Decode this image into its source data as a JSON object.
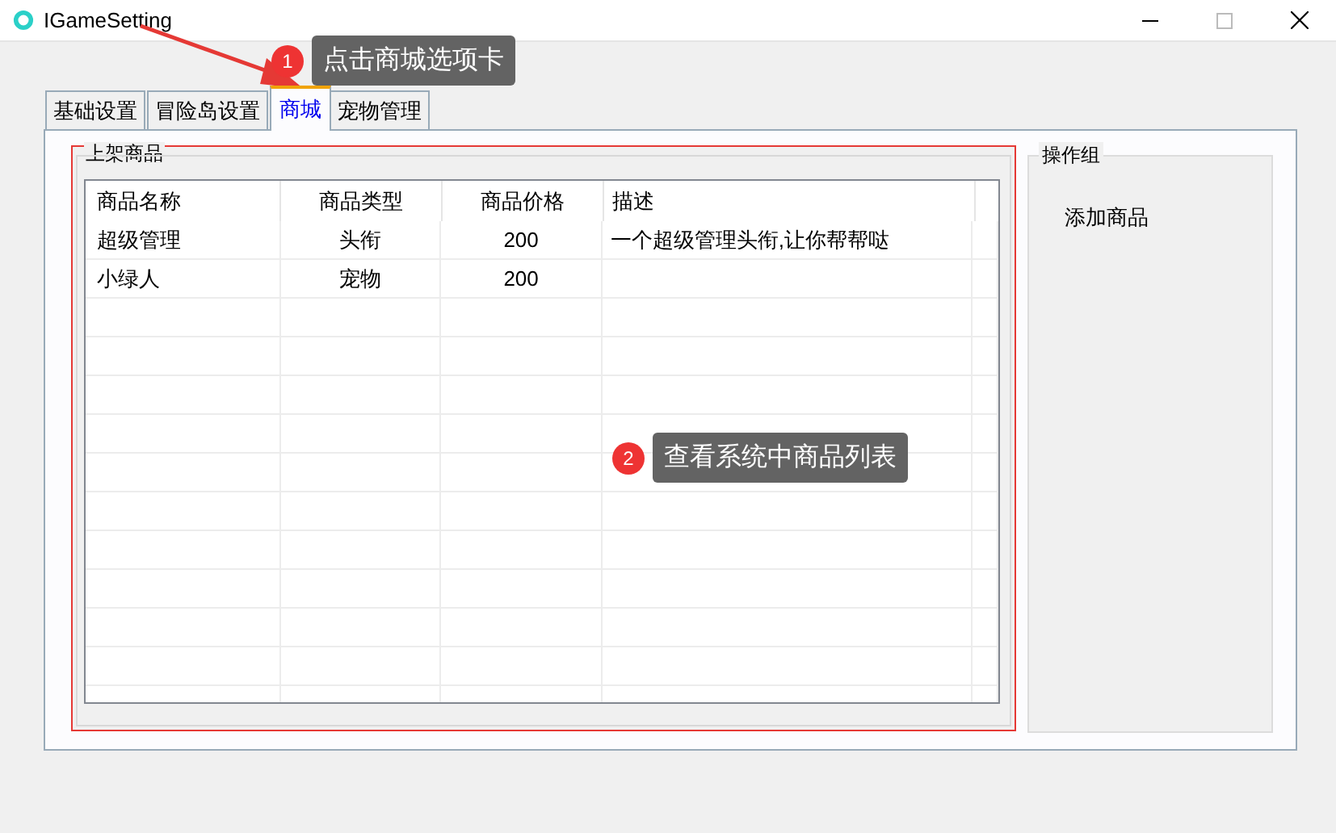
{
  "window": {
    "title": "IGameSetting"
  },
  "tabs": [
    {
      "label": "基础设置",
      "selected": false
    },
    {
      "label": "冒险岛设置",
      "selected": false
    },
    {
      "label": "商城",
      "selected": true
    },
    {
      "label": "宠物管理",
      "selected": false
    }
  ],
  "product_group": {
    "title": "上架商品",
    "table": {
      "columns": [
        "商品名称",
        "商品类型",
        "商品价格",
        "描述"
      ],
      "rows": [
        [
          "超级管理",
          "头衔",
          "200",
          "一个超级管理头衔,让你帮帮哒"
        ],
        [
          "小绿人",
          "宠物",
          "200",
          ""
        ]
      ]
    }
  },
  "action_group": {
    "title": "操作组",
    "buttons": [
      "添加商品"
    ]
  },
  "callouts": [
    {
      "number": "1",
      "text": "点击商城选项卡"
    },
    {
      "number": "2",
      "text": "查看系统中商品列表"
    }
  ]
}
